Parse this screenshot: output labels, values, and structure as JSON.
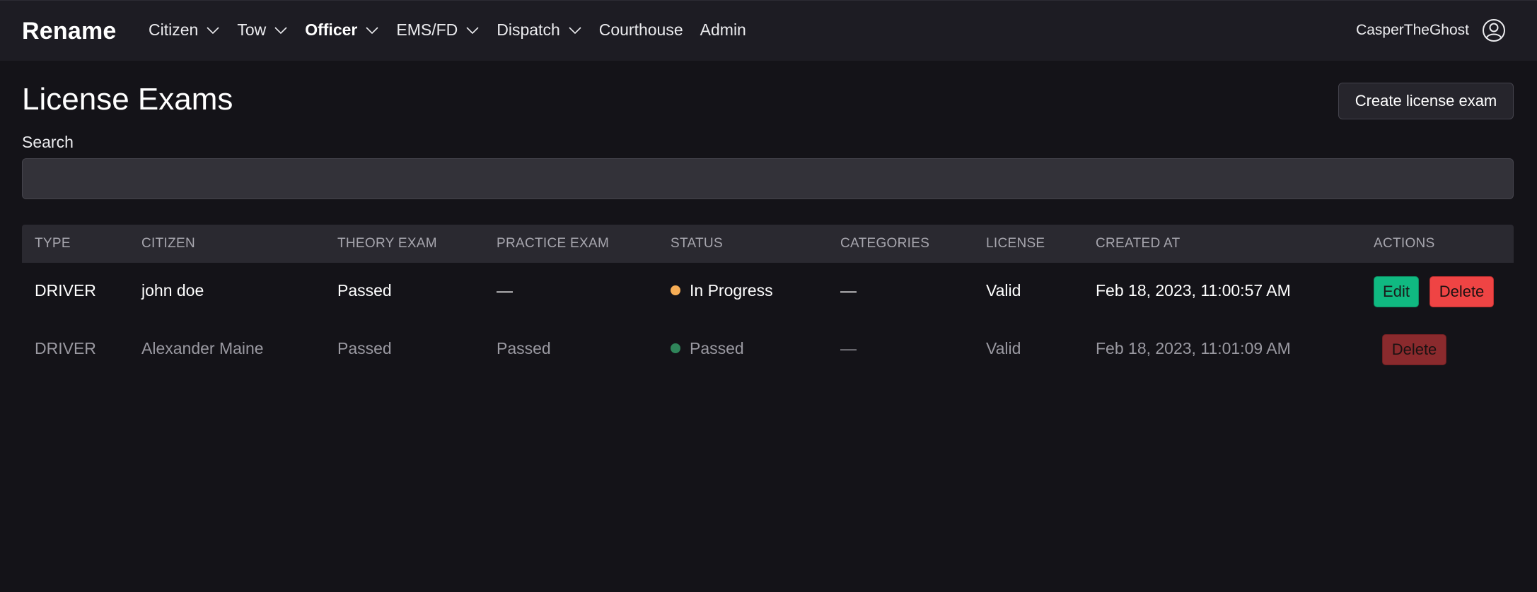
{
  "navbar": {
    "brand": "Rename",
    "items": [
      {
        "label": "Citizen",
        "dropdown": true,
        "active": false
      },
      {
        "label": "Tow",
        "dropdown": true,
        "active": false
      },
      {
        "label": "Officer",
        "dropdown": true,
        "active": true
      },
      {
        "label": "EMS/FD",
        "dropdown": true,
        "active": false
      },
      {
        "label": "Dispatch",
        "dropdown": true,
        "active": false
      },
      {
        "label": "Courthouse",
        "dropdown": false,
        "active": false
      },
      {
        "label": "Admin",
        "dropdown": false,
        "active": false
      }
    ],
    "username": "CasperTheGhost",
    "user_icon": "user-circle-icon"
  },
  "page": {
    "title": "License Exams",
    "create_button": "Create license exam",
    "search_label": "Search",
    "search_value": ""
  },
  "table": {
    "headers": [
      "Type",
      "Citizen",
      "Theory Exam",
      "Practice Exam",
      "Status",
      "Categories",
      "License",
      "Created At",
      "Actions"
    ],
    "rows": [
      {
        "type": "DRIVER",
        "citizen": "john doe",
        "theory_exam": "Passed",
        "practice_exam": "—",
        "status": "In Progress",
        "status_color": "#f6ad55",
        "categories": "—",
        "license": "Valid",
        "created_at": "Feb 18, 2023, 11:00:57 AM",
        "edit_label": "Edit",
        "delete_label": "Delete"
      },
      {
        "type": "DRIVER",
        "citizen": "Alexander Maine",
        "theory_exam": "Passed",
        "practice_exam": "Passed",
        "status": "Passed",
        "status_color": "#2f855a",
        "categories": "—",
        "license": "Valid",
        "created_at": "Feb 18, 2023, 11:01:09 AM",
        "delete_label": "Delete"
      }
    ]
  },
  "colors": {
    "background": "#141318",
    "navbar": "#1d1c23",
    "edit_button": "#10b981",
    "delete_button": "#ef4444"
  }
}
